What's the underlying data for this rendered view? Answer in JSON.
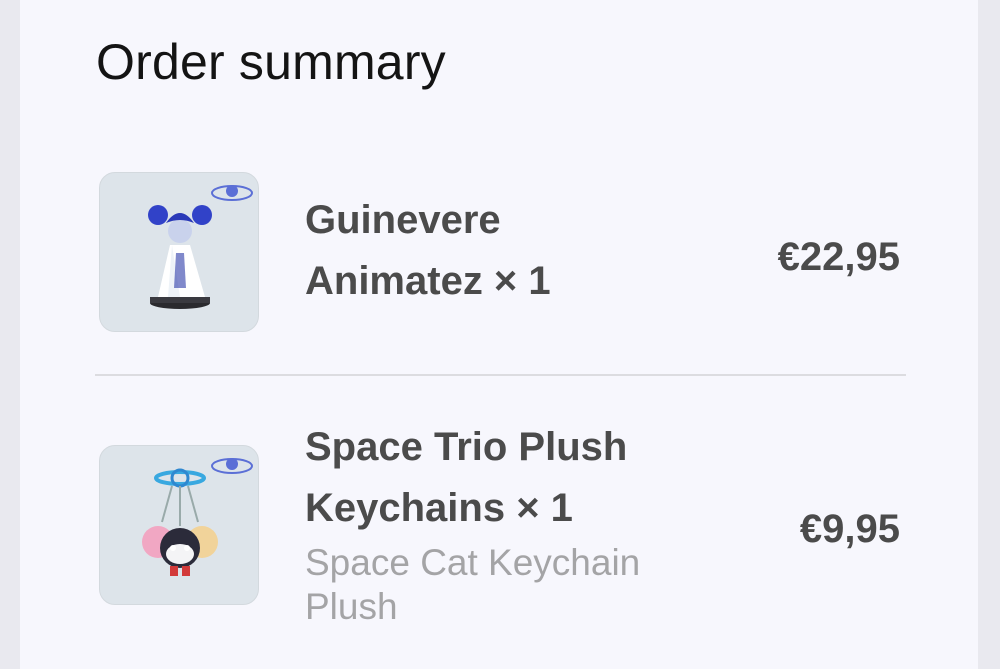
{
  "order_summary": {
    "title": "Order summary",
    "items": [
      {
        "name_line1": "Guinevere",
        "name_line2": "Animatez × 1",
        "variant": "",
        "price": "€22,95",
        "thumbnail_icon": "figurine-image"
      },
      {
        "name_line1": "Space Trio Plush",
        "name_line2": "Keychains × 1",
        "variant_line1": "Space Cat Keychain",
        "variant_line2": "Plush",
        "price": "€9,95",
        "thumbnail_icon": "keychain-image"
      }
    ]
  },
  "colors": {
    "background": "#f7f7fd",
    "outer_background": "#e9e9ef",
    "text_primary": "#141414",
    "text_item": "#4b4b4b",
    "text_variant": "#a4a4a6",
    "divider": "#dcdce0"
  }
}
